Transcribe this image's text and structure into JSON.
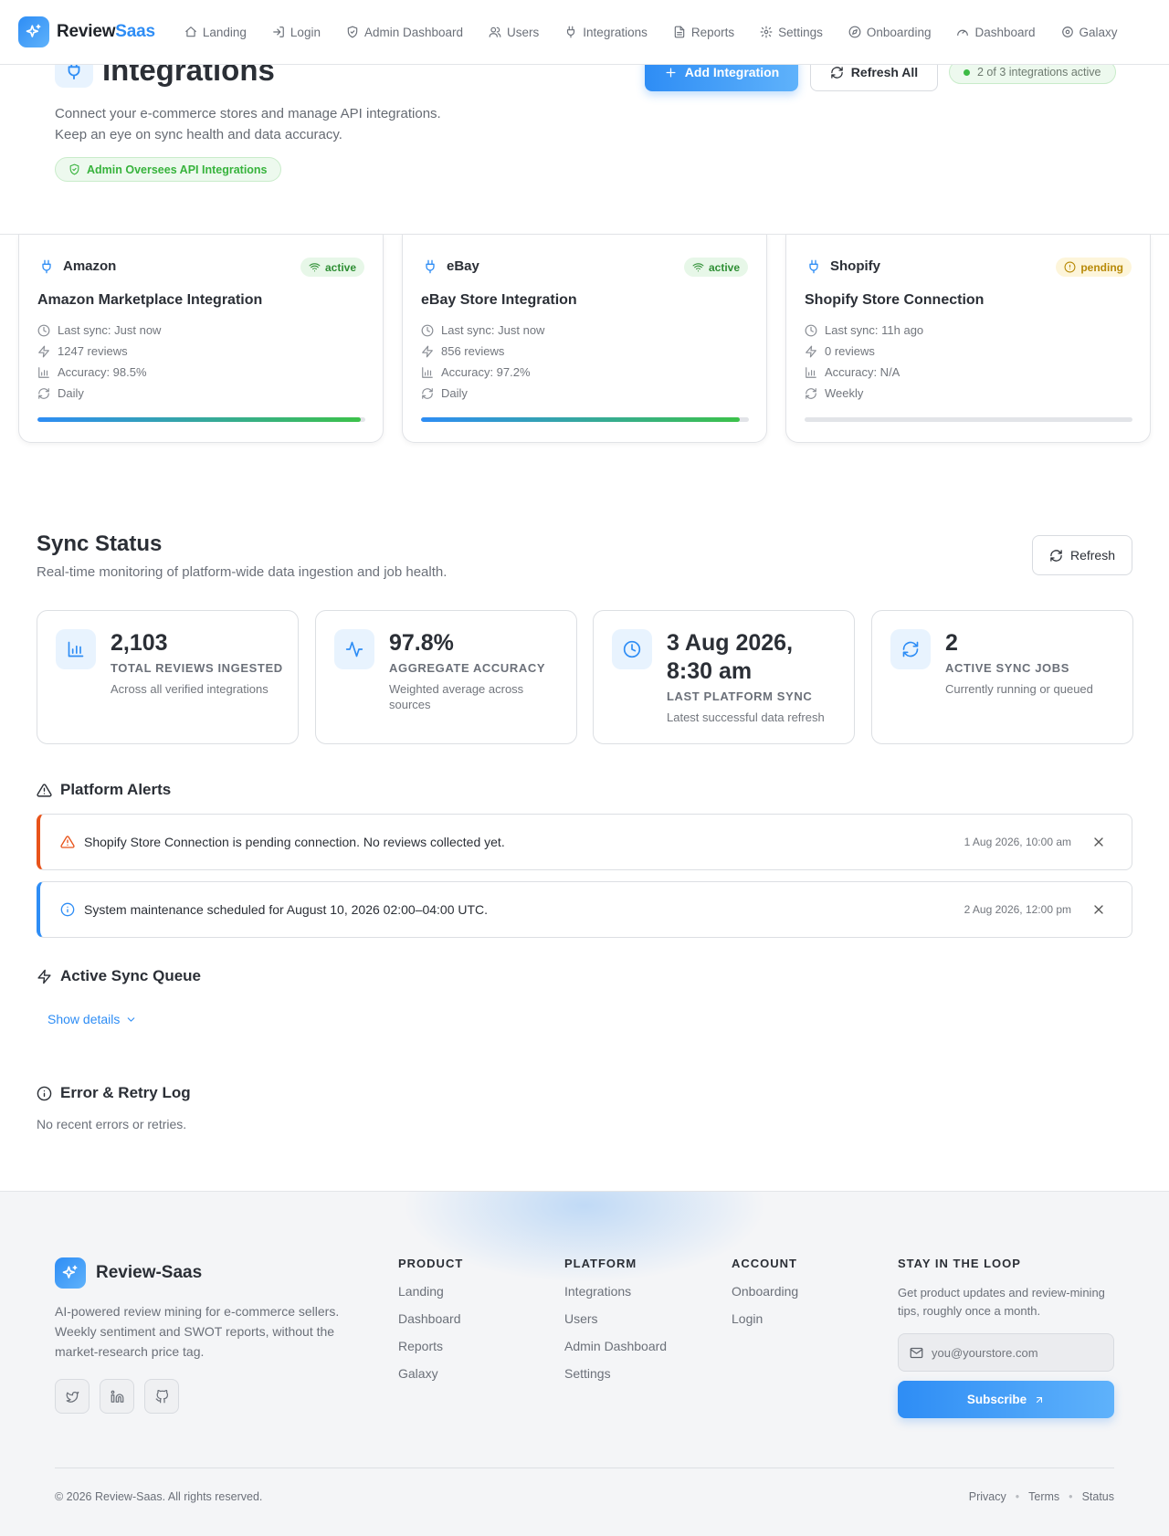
{
  "nav": {
    "brand_a": "Review",
    "brand_b": "Saas",
    "items": [
      {
        "label": "Landing",
        "icon": "home-icon"
      },
      {
        "label": "Login",
        "icon": "login-icon"
      },
      {
        "label": "Admin Dashboard",
        "icon": "shield-icon"
      },
      {
        "label": "Users",
        "icon": "users-icon"
      },
      {
        "label": "Integrations",
        "icon": "plug-icon"
      },
      {
        "label": "Reports",
        "icon": "file-icon"
      },
      {
        "label": "Settings",
        "icon": "gear-icon"
      },
      {
        "label": "Onboarding",
        "icon": "compass-icon"
      },
      {
        "label": "Dashboard",
        "icon": "gauge-icon"
      },
      {
        "label": "Galaxy",
        "icon": "galaxy-icon"
      }
    ]
  },
  "header": {
    "title": "Integrations",
    "subtitle_1": "Connect your e-commerce stores and manage API integrations.",
    "subtitle_2": "Keep an eye on sync health and data accuracy.",
    "badge": "Admin Oversees API Integrations",
    "add_button": "Add Integration",
    "refresh_all_button": "Refresh All",
    "active_pill": "2 of 3 integrations active"
  },
  "platforms": [
    {
      "name": "Amazon",
      "status": "active",
      "title": "Amazon Marketplace Integration",
      "last_sync": "Last sync: Just now",
      "reviews": "1247 reviews",
      "accuracy": "Accuracy: 98.5%",
      "frequency": "Daily",
      "progress": 0.985
    },
    {
      "name": "eBay",
      "status": "active",
      "title": "eBay Store Integration",
      "last_sync": "Last sync: Just now",
      "reviews": "856 reviews",
      "accuracy": "Accuracy: 97.2%",
      "frequency": "Daily",
      "progress": 0.972
    },
    {
      "name": "Shopify",
      "status": "pending",
      "title": "Shopify Store Connection",
      "last_sync": "Last sync: 11h ago",
      "reviews": "0 reviews",
      "accuracy": "Accuracy: N/A",
      "frequency": "Weekly",
      "progress": 0
    }
  ],
  "sync": {
    "title": "Sync Status",
    "subtitle": "Real-time monitoring of platform-wide data ingestion and job health.",
    "refresh_button": "Refresh",
    "stats": [
      {
        "value": "2,103",
        "label": "Total Reviews Ingested",
        "desc": "Across all verified integrations",
        "icon": "bar-chart-icon"
      },
      {
        "value": "97.8%",
        "label": "Aggregate Accuracy",
        "desc": "Weighted average across sources",
        "icon": "activity-icon"
      },
      {
        "value": "3 Aug 2026, 8:30 am",
        "label": "Last Platform Sync",
        "desc": "Latest successful data refresh",
        "icon": "clock-icon"
      },
      {
        "value": "2",
        "label": "Active Sync Jobs",
        "desc": "Currently running or queued",
        "icon": "refresh-icon"
      }
    ]
  },
  "alerts": {
    "title": "Platform Alerts",
    "items": [
      {
        "type": "warning",
        "message": "Shopify Store Connection is pending connection. No reviews collected yet.",
        "time": "1 Aug 2026, 10:00 am"
      },
      {
        "type": "info",
        "message": "System maintenance scheduled for August 10, 2026 02:00–04:00 UTC.",
        "time": "2 Aug 2026, 12:00 pm"
      }
    ]
  },
  "queue": {
    "title": "Active Sync Queue",
    "show_details": "Show details"
  },
  "errors": {
    "title": "Error & Retry Log",
    "empty": "No recent errors or retries."
  },
  "footer": {
    "brand": "Review-Saas",
    "desc": "AI-powered review mining for e-commerce sellers. Weekly sentiment and SWOT reports, without the market-research price tag.",
    "columns": [
      {
        "title": "Product",
        "links": [
          "Landing",
          "Dashboard",
          "Reports",
          "Galaxy"
        ]
      },
      {
        "title": "Platform",
        "links": [
          "Integrations",
          "Users",
          "Admin Dashboard",
          "Settings"
        ]
      },
      {
        "title": "Account",
        "links": [
          "Onboarding",
          "Login"
        ]
      }
    ],
    "loop_title": "Stay in the Loop",
    "loop_desc": "Get product updates and review-mining tips, roughly once a month.",
    "email_placeholder": "you@yourstore.com",
    "subscribe": "Subscribe",
    "copyright": "© 2026 Review-Saas. All rights reserved.",
    "legal": [
      "Privacy",
      "Terms",
      "Status"
    ]
  },
  "colors": {
    "accent": "#2e8df5",
    "success": "#3dbb45",
    "warning": "#e8531a",
    "pending": "#b88a08"
  }
}
